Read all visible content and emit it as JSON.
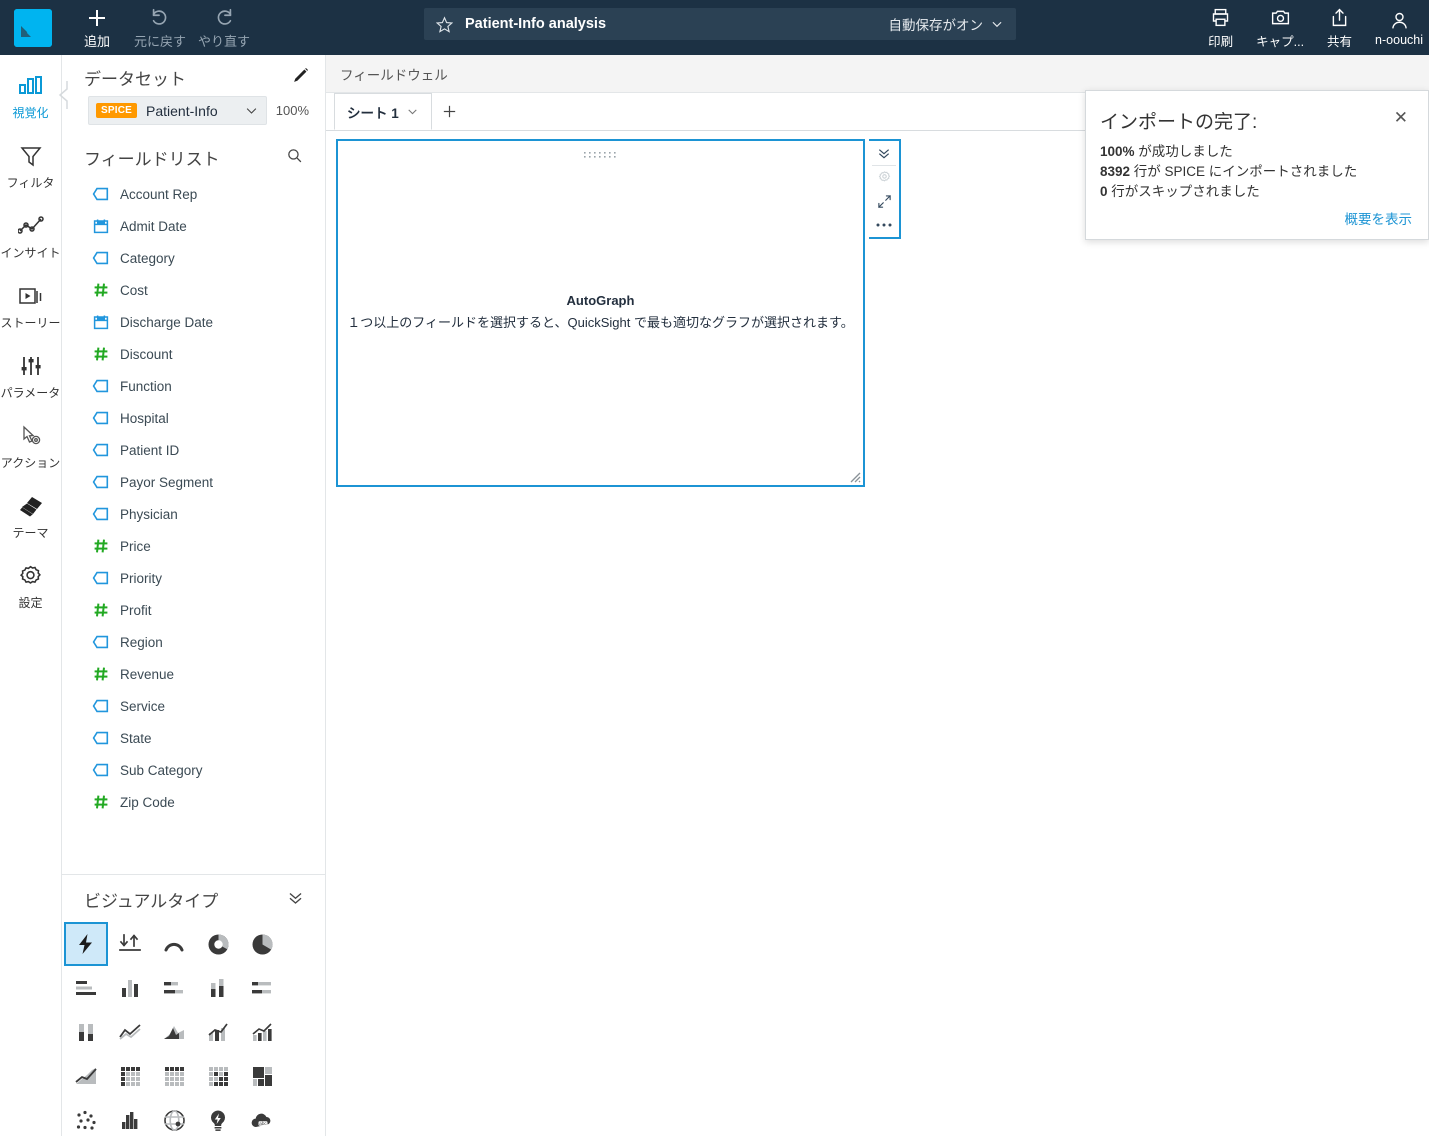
{
  "topbar": {
    "logo_name": "quicksight-logo",
    "add_label": "追加",
    "undo_label": "元に戻す",
    "redo_label": "やり直す",
    "analysis_title": "Patient-Info analysis",
    "autosave_label": "自動保存がオン",
    "print_label": "印刷",
    "capture_label": "キャプ...",
    "share_label": "共有",
    "user_label": "n-oouchi",
    "bg_color": "#1c3144",
    "title_bg_color": "#2b4154"
  },
  "rail": {
    "items": [
      {
        "label": "視覚化",
        "icon": "bar-chart-icon",
        "active": true
      },
      {
        "label": "フィルタ",
        "icon": "funnel-icon",
        "active": false
      },
      {
        "label": "インサイト",
        "icon": "insight-line-icon",
        "active": false
      },
      {
        "label": "ストーリー",
        "icon": "story-play-icon",
        "active": false
      },
      {
        "label": "パラメータ",
        "icon": "sliders-icon",
        "active": false
      },
      {
        "label": "アクション",
        "icon": "cursor-gear-icon",
        "active": false
      },
      {
        "label": "テーマ",
        "icon": "paintbrush-icon",
        "active": false
      },
      {
        "label": "設定",
        "icon": "gear-icon",
        "active": false
      }
    ],
    "accent_color": "#0b99d6"
  },
  "dataset": {
    "title": "データセット",
    "edit_icon": "pencil-icon",
    "badge": "SPICE",
    "badge_color": "#ff9900",
    "name": "Patient-Info",
    "percent": "100%"
  },
  "fieldlist": {
    "title": "フィールドリスト",
    "search_icon": "search-icon",
    "fields": [
      {
        "name": "Account Rep",
        "type": "string"
      },
      {
        "name": "Admit Date",
        "type": "date"
      },
      {
        "name": "Category",
        "type": "string"
      },
      {
        "name": "Cost",
        "type": "number"
      },
      {
        "name": "Discharge Date",
        "type": "date"
      },
      {
        "name": "Discount",
        "type": "number"
      },
      {
        "name": "Function",
        "type": "string"
      },
      {
        "name": "Hospital",
        "type": "string"
      },
      {
        "name": "Patient ID",
        "type": "string"
      },
      {
        "name": "Payor Segment",
        "type": "string"
      },
      {
        "name": "Physician",
        "type": "string"
      },
      {
        "name": "Price",
        "type": "number"
      },
      {
        "name": "Priority",
        "type": "string"
      },
      {
        "name": "Profit",
        "type": "number"
      },
      {
        "name": "Region",
        "type": "string"
      },
      {
        "name": "Revenue",
        "type": "number"
      },
      {
        "name": "Service",
        "type": "string"
      },
      {
        "name": "State",
        "type": "string"
      },
      {
        "name": "Sub Category",
        "type": "string"
      },
      {
        "name": "Zip Code",
        "type": "number"
      }
    ],
    "string_color": "#2196dd",
    "date_color": "#2196dd",
    "number_color": "#22a922"
  },
  "visualtype": {
    "title": "ビジュアルタイプ",
    "collapse_icon": "chevron-double-down-icon",
    "items": [
      {
        "icon": "autograph-icon",
        "selected": true
      },
      {
        "icon": "kpi-icon",
        "selected": false
      },
      {
        "icon": "gauge-icon",
        "selected": false
      },
      {
        "icon": "donut-icon",
        "selected": false
      },
      {
        "icon": "pie-icon",
        "selected": false
      },
      {
        "icon": "horizontal-bar-icon",
        "selected": false
      },
      {
        "icon": "vertical-bar-icon",
        "selected": false
      },
      {
        "icon": "horizontal-stacked-bar-icon",
        "selected": false
      },
      {
        "icon": "vertical-stacked-bar-icon",
        "selected": false
      },
      {
        "icon": "horizontal-100-bar-icon",
        "selected": false
      },
      {
        "icon": "vertical-100-bar-icon",
        "selected": false
      },
      {
        "icon": "line-chart-icon",
        "selected": false
      },
      {
        "icon": "area-chart-icon",
        "selected": false
      },
      {
        "icon": "combo-chart-icon",
        "selected": false
      },
      {
        "icon": "combo-stacked-chart-icon",
        "selected": false
      },
      {
        "icon": "stacked-area-icon",
        "selected": false
      },
      {
        "icon": "pivot-table-icon",
        "selected": false
      },
      {
        "icon": "table-icon",
        "selected": false
      },
      {
        "icon": "heatmap-icon",
        "selected": false
      },
      {
        "icon": "treemap-icon",
        "selected": false
      },
      {
        "icon": "scatter-plot-icon",
        "selected": false
      },
      {
        "icon": "histogram-icon",
        "selected": false
      },
      {
        "icon": "geospatial-map-icon",
        "selected": false
      },
      {
        "icon": "insight-bulb-icon",
        "selected": false
      },
      {
        "icon": "word-cloud-icon",
        "selected": false
      }
    ],
    "selected_bg": "#cfe9f9",
    "selected_border": "#1c94d4"
  },
  "main": {
    "fieldwell_label": "フィールドウェル",
    "sheet_tab_label": "シート 1",
    "sheet_add_icon": "plus-icon",
    "visual": {
      "title": "AutoGraph",
      "subtitle": "１つ以上のフィールドを選択すると、QuickSight で最も適切なグラフが選択されます。",
      "border_color": "#1c94d4",
      "toolbar": [
        {
          "icon": "chevron-double-down-icon",
          "enabled": true
        },
        {
          "icon": "gear-icon",
          "enabled": false
        },
        {
          "icon": "expand-arrows-icon",
          "enabled": true
        },
        {
          "icon": "ellipsis-icon",
          "enabled": true
        }
      ]
    }
  },
  "notification": {
    "title": "インポートの完了:",
    "close_icon": "close-icon",
    "line1_bold": "100%",
    "line1_rest": " が成功しました",
    "line2_bold": "8392",
    "line2_rest": " 行が SPICE にインポートされました",
    "line3_bold": "0",
    "line3_rest": " 行がスキップされました",
    "link_label": "概要を表示",
    "link_color": "#1c94d4"
  }
}
